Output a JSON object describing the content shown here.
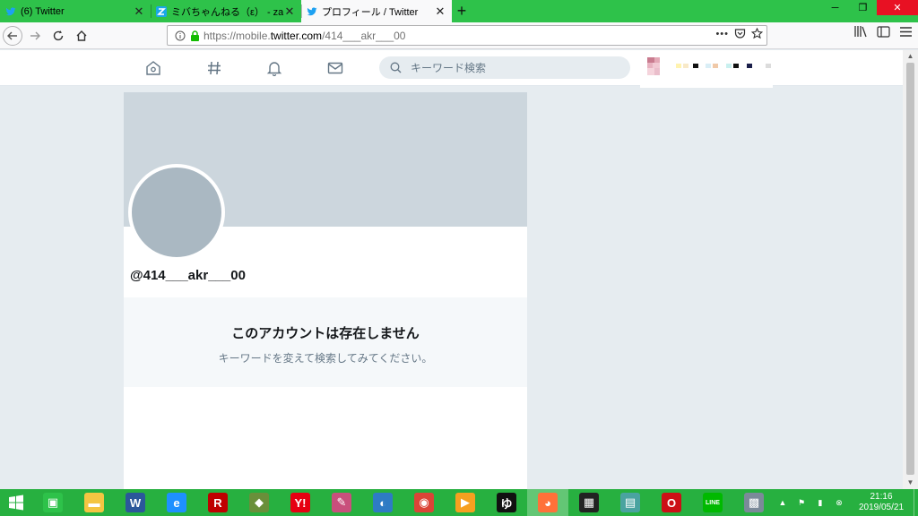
{
  "browser": {
    "tabs": [
      {
        "title": "(6) Twitter",
        "favicon": "twitter-bird-icon"
      },
      {
        "title": "ミバちゃんねる（ε） - zawazaw",
        "favicon": "z-logo-icon"
      },
      {
        "title": "プロフィール / Twitter",
        "favicon": "twitter-bird-icon"
      }
    ],
    "new_tab_label": "+",
    "url": {
      "scheme": "https://mobile.",
      "host": "twitter.com",
      "path": "/414___akr___00"
    },
    "page_actions_label": "•••"
  },
  "twitter": {
    "search_placeholder": "キーワード検索",
    "profile": {
      "handle": "@414___akr___00",
      "empty_title": "このアカウントは存在しません",
      "empty_subtitle": "キーワードを変えて検索してみてください。"
    }
  },
  "taskbar": {
    "apps": [
      {
        "name": "store-icon",
        "color": "#2ec24a",
        "glyph": "▣"
      },
      {
        "name": "file-explorer-icon",
        "color": "#f4c542",
        "glyph": "▬"
      },
      {
        "name": "word-icon",
        "color": "#2b579a",
        "glyph": "W"
      },
      {
        "name": "internet-explorer-icon",
        "color": "#1e90ff",
        "glyph": "e"
      },
      {
        "name": "rakuten-icon",
        "color": "#bf0000",
        "glyph": "R"
      },
      {
        "name": "game-icon",
        "color": "#6a8f3a",
        "glyph": "◆"
      },
      {
        "name": "yahoo-icon",
        "color": "#e60012",
        "glyph": "Y!"
      },
      {
        "name": "paint-icon",
        "color": "#c94f7c",
        "glyph": "✎"
      },
      {
        "name": "network-globe-icon",
        "color": "#2e7bc4",
        "glyph": "◐"
      },
      {
        "name": "chrome-icon",
        "color": "#db4437",
        "glyph": "◉"
      },
      {
        "name": "media-player-icon",
        "color": "#f6a020",
        "glyph": "▶"
      },
      {
        "name": "yu-app-icon",
        "color": "#111111",
        "glyph": "ゆ"
      },
      {
        "name": "firefox-icon",
        "color": "#ff7139",
        "glyph": "◕"
      },
      {
        "name": "video-editor-icon",
        "color": "#222222",
        "glyph": "▦"
      },
      {
        "name": "book-app-icon",
        "color": "#4aa3a0",
        "glyph": "▤"
      },
      {
        "name": "opera-icon",
        "color": "#cc0f16",
        "glyph": "O"
      },
      {
        "name": "line-icon",
        "color": "#00b900",
        "glyph": "LINE"
      },
      {
        "name": "photos-app-icon",
        "color": "#7b8a99",
        "glyph": "▩"
      }
    ],
    "active_app_index": 12,
    "clock_time": "21:16",
    "clock_date": "2019/05/21"
  },
  "colors": {
    "tab_bar": "#2ec24a",
    "taskbar": "#27b040",
    "twitter_blue": "#1da1f2",
    "banner": "#ccd6dd"
  }
}
